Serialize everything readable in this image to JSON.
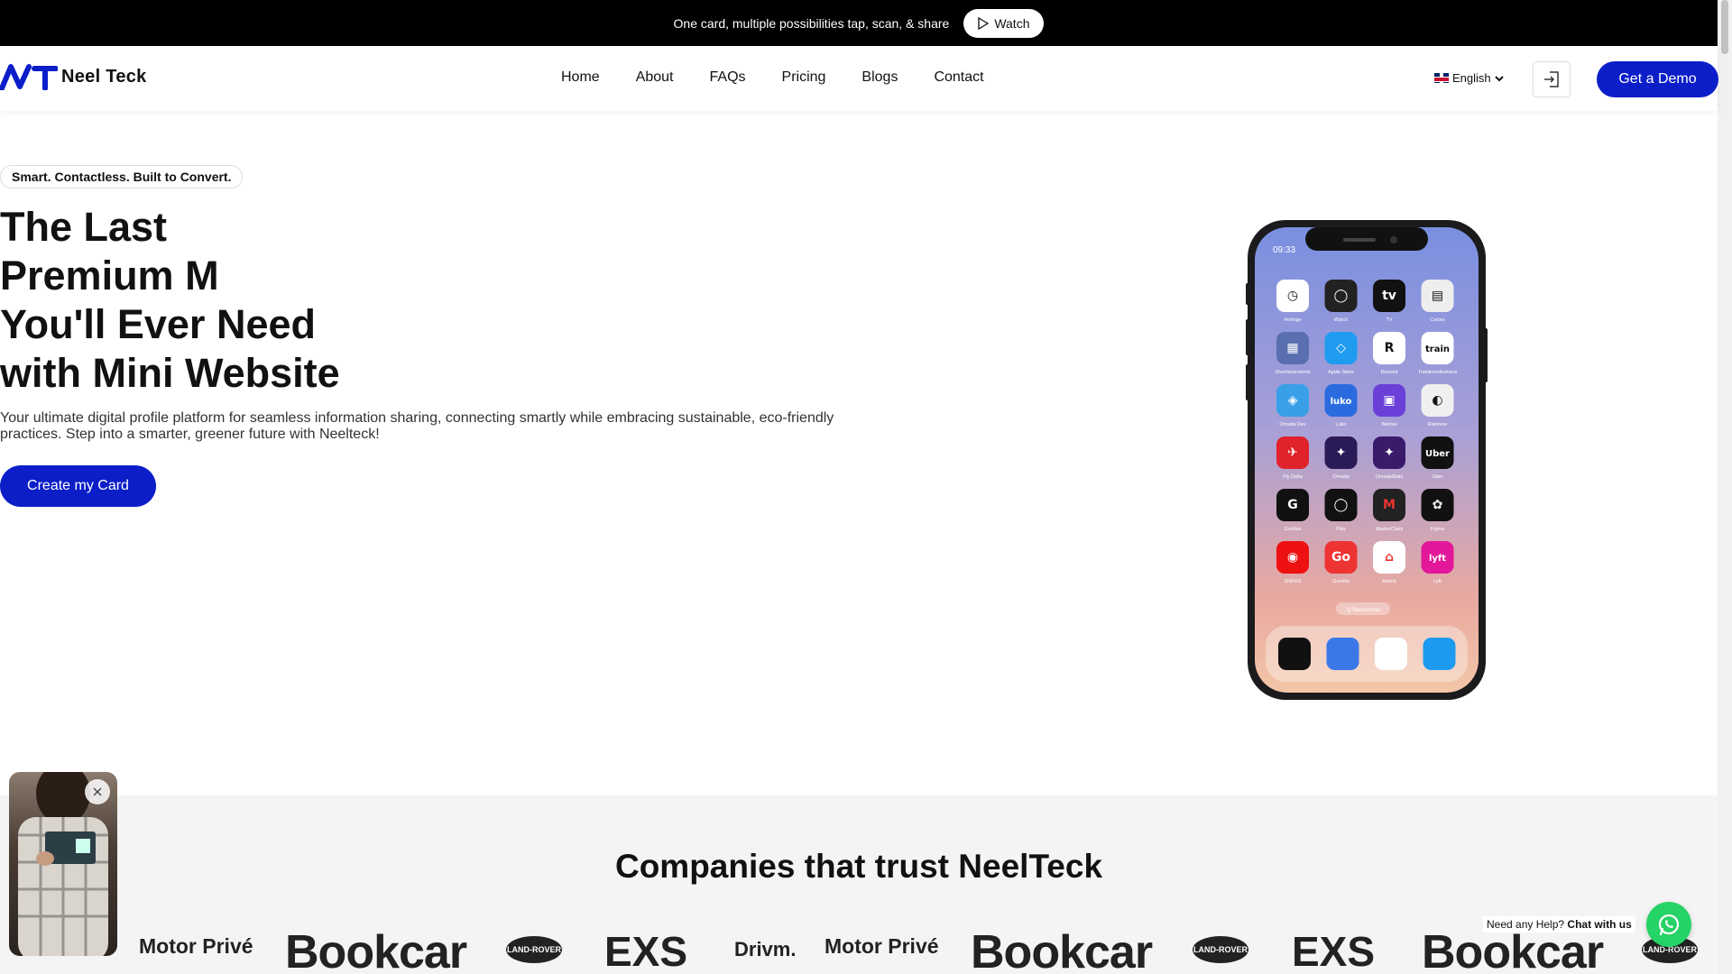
{
  "topbar": {
    "text": "One card, multiple possibilities tap, scan, & share",
    "watch_label": "Watch"
  },
  "header": {
    "brand": "Neel Teck",
    "nav": [
      "Home",
      "About",
      "FAQs",
      "Pricing",
      "Blogs",
      "Contact"
    ],
    "language": "English",
    "demo_label": "Get a Demo",
    "login_icon": "login-icon"
  },
  "hero": {
    "badge": "Smart. Contactless. Built to Convert.",
    "title_lines": [
      "The Last",
      "Premium M",
      "You'll Ever Need",
      "with Mini Website"
    ],
    "description": "Your ultimate digital profile platform for seamless information sharing, connecting smartly while embracing sustainable, eco-friendly practices. Step into a smarter, greener future with Neelteck!",
    "cta_label": "Create my Card"
  },
  "phone": {
    "time": "09:33",
    "apps": [
      "Horloge",
      "Watch",
      "TV",
      "Cartes",
      "Divertissements",
      "Apple Store",
      "Revolut",
      "Trainlineelkolness",
      "Omada Dev",
      "Luko",
      "Betrise",
      "Rainbow",
      "Fly Delta",
      "Omada",
      "OmadaStats",
      "Uber",
      "Gorillas",
      "Play",
      "MasterClass",
      "Figma",
      "SNKRS",
      "Gorsilla",
      "Airbnb",
      "Lyft"
    ],
    "search_label": "Q Rechercher",
    "dock": [
      "tiktok",
      "messenger",
      "AF",
      "twitter"
    ]
  },
  "trusted": {
    "title": "Companies that trust NeelTeck",
    "logos": [
      "Drivm.",
      "Motor Privé",
      "Bookcar",
      "LAND-ROVER",
      "EXS",
      "Drivm.",
      "Motor Privé",
      "Bookcar",
      "LAND-ROVER",
      "EXS",
      "Bookcar",
      "LAND-ROVER"
    ]
  },
  "help": {
    "prefix": "Need any Help?",
    "link": "Chat with us"
  },
  "colors": {
    "primary": "#0b1ec8",
    "topbar": "#000000",
    "whatsapp": "#25d366"
  }
}
